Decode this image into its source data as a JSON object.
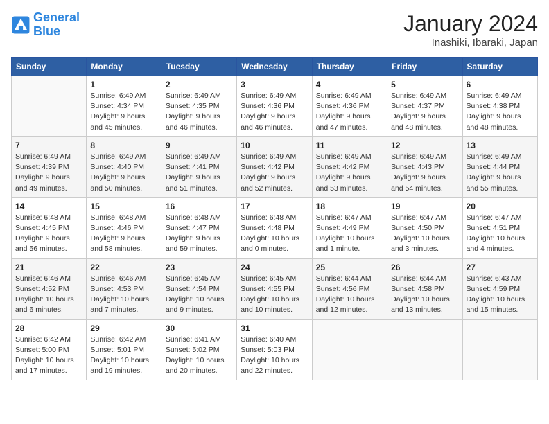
{
  "logo": {
    "line1": "General",
    "line2": "Blue"
  },
  "title": "January 2024",
  "subtitle": "Inashiki, Ibaraki, Japan",
  "days_header": [
    "Sunday",
    "Monday",
    "Tuesday",
    "Wednesday",
    "Thursday",
    "Friday",
    "Saturday"
  ],
  "weeks": [
    [
      {
        "num": "",
        "sunrise": "",
        "sunset": "",
        "daylight": ""
      },
      {
        "num": "1",
        "sunrise": "Sunrise: 6:49 AM",
        "sunset": "Sunset: 4:34 PM",
        "daylight": "Daylight: 9 hours and 45 minutes."
      },
      {
        "num": "2",
        "sunrise": "Sunrise: 6:49 AM",
        "sunset": "Sunset: 4:35 PM",
        "daylight": "Daylight: 9 hours and 46 minutes."
      },
      {
        "num": "3",
        "sunrise": "Sunrise: 6:49 AM",
        "sunset": "Sunset: 4:36 PM",
        "daylight": "Daylight: 9 hours and 46 minutes."
      },
      {
        "num": "4",
        "sunrise": "Sunrise: 6:49 AM",
        "sunset": "Sunset: 4:36 PM",
        "daylight": "Daylight: 9 hours and 47 minutes."
      },
      {
        "num": "5",
        "sunrise": "Sunrise: 6:49 AM",
        "sunset": "Sunset: 4:37 PM",
        "daylight": "Daylight: 9 hours and 48 minutes."
      },
      {
        "num": "6",
        "sunrise": "Sunrise: 6:49 AM",
        "sunset": "Sunset: 4:38 PM",
        "daylight": "Daylight: 9 hours and 48 minutes."
      }
    ],
    [
      {
        "num": "7",
        "sunrise": "Sunrise: 6:49 AM",
        "sunset": "Sunset: 4:39 PM",
        "daylight": "Daylight: 9 hours and 49 minutes."
      },
      {
        "num": "8",
        "sunrise": "Sunrise: 6:49 AM",
        "sunset": "Sunset: 4:40 PM",
        "daylight": "Daylight: 9 hours and 50 minutes."
      },
      {
        "num": "9",
        "sunrise": "Sunrise: 6:49 AM",
        "sunset": "Sunset: 4:41 PM",
        "daylight": "Daylight: 9 hours and 51 minutes."
      },
      {
        "num": "10",
        "sunrise": "Sunrise: 6:49 AM",
        "sunset": "Sunset: 4:42 PM",
        "daylight": "Daylight: 9 hours and 52 minutes."
      },
      {
        "num": "11",
        "sunrise": "Sunrise: 6:49 AM",
        "sunset": "Sunset: 4:42 PM",
        "daylight": "Daylight: 9 hours and 53 minutes."
      },
      {
        "num": "12",
        "sunrise": "Sunrise: 6:49 AM",
        "sunset": "Sunset: 4:43 PM",
        "daylight": "Daylight: 9 hours and 54 minutes."
      },
      {
        "num": "13",
        "sunrise": "Sunrise: 6:49 AM",
        "sunset": "Sunset: 4:44 PM",
        "daylight": "Daylight: 9 hours and 55 minutes."
      }
    ],
    [
      {
        "num": "14",
        "sunrise": "Sunrise: 6:48 AM",
        "sunset": "Sunset: 4:45 PM",
        "daylight": "Daylight: 9 hours and 56 minutes."
      },
      {
        "num": "15",
        "sunrise": "Sunrise: 6:48 AM",
        "sunset": "Sunset: 4:46 PM",
        "daylight": "Daylight: 9 hours and 58 minutes."
      },
      {
        "num": "16",
        "sunrise": "Sunrise: 6:48 AM",
        "sunset": "Sunset: 4:47 PM",
        "daylight": "Daylight: 9 hours and 59 minutes."
      },
      {
        "num": "17",
        "sunrise": "Sunrise: 6:48 AM",
        "sunset": "Sunset: 4:48 PM",
        "daylight": "Daylight: 10 hours and 0 minutes."
      },
      {
        "num": "18",
        "sunrise": "Sunrise: 6:47 AM",
        "sunset": "Sunset: 4:49 PM",
        "daylight": "Daylight: 10 hours and 1 minute."
      },
      {
        "num": "19",
        "sunrise": "Sunrise: 6:47 AM",
        "sunset": "Sunset: 4:50 PM",
        "daylight": "Daylight: 10 hours and 3 minutes."
      },
      {
        "num": "20",
        "sunrise": "Sunrise: 6:47 AM",
        "sunset": "Sunset: 4:51 PM",
        "daylight": "Daylight: 10 hours and 4 minutes."
      }
    ],
    [
      {
        "num": "21",
        "sunrise": "Sunrise: 6:46 AM",
        "sunset": "Sunset: 4:52 PM",
        "daylight": "Daylight: 10 hours and 6 minutes."
      },
      {
        "num": "22",
        "sunrise": "Sunrise: 6:46 AM",
        "sunset": "Sunset: 4:53 PM",
        "daylight": "Daylight: 10 hours and 7 minutes."
      },
      {
        "num": "23",
        "sunrise": "Sunrise: 6:45 AM",
        "sunset": "Sunset: 4:54 PM",
        "daylight": "Daylight: 10 hours and 9 minutes."
      },
      {
        "num": "24",
        "sunrise": "Sunrise: 6:45 AM",
        "sunset": "Sunset: 4:55 PM",
        "daylight": "Daylight: 10 hours and 10 minutes."
      },
      {
        "num": "25",
        "sunrise": "Sunrise: 6:44 AM",
        "sunset": "Sunset: 4:56 PM",
        "daylight": "Daylight: 10 hours and 12 minutes."
      },
      {
        "num": "26",
        "sunrise": "Sunrise: 6:44 AM",
        "sunset": "Sunset: 4:58 PM",
        "daylight": "Daylight: 10 hours and 13 minutes."
      },
      {
        "num": "27",
        "sunrise": "Sunrise: 6:43 AM",
        "sunset": "Sunset: 4:59 PM",
        "daylight": "Daylight: 10 hours and 15 minutes."
      }
    ],
    [
      {
        "num": "28",
        "sunrise": "Sunrise: 6:42 AM",
        "sunset": "Sunset: 5:00 PM",
        "daylight": "Daylight: 10 hours and 17 minutes."
      },
      {
        "num": "29",
        "sunrise": "Sunrise: 6:42 AM",
        "sunset": "Sunset: 5:01 PM",
        "daylight": "Daylight: 10 hours and 19 minutes."
      },
      {
        "num": "30",
        "sunrise": "Sunrise: 6:41 AM",
        "sunset": "Sunset: 5:02 PM",
        "daylight": "Daylight: 10 hours and 20 minutes."
      },
      {
        "num": "31",
        "sunrise": "Sunrise: 6:40 AM",
        "sunset": "Sunset: 5:03 PM",
        "daylight": "Daylight: 10 hours and 22 minutes."
      },
      {
        "num": "",
        "sunrise": "",
        "sunset": "",
        "daylight": ""
      },
      {
        "num": "",
        "sunrise": "",
        "sunset": "",
        "daylight": ""
      },
      {
        "num": "",
        "sunrise": "",
        "sunset": "",
        "daylight": ""
      }
    ]
  ]
}
